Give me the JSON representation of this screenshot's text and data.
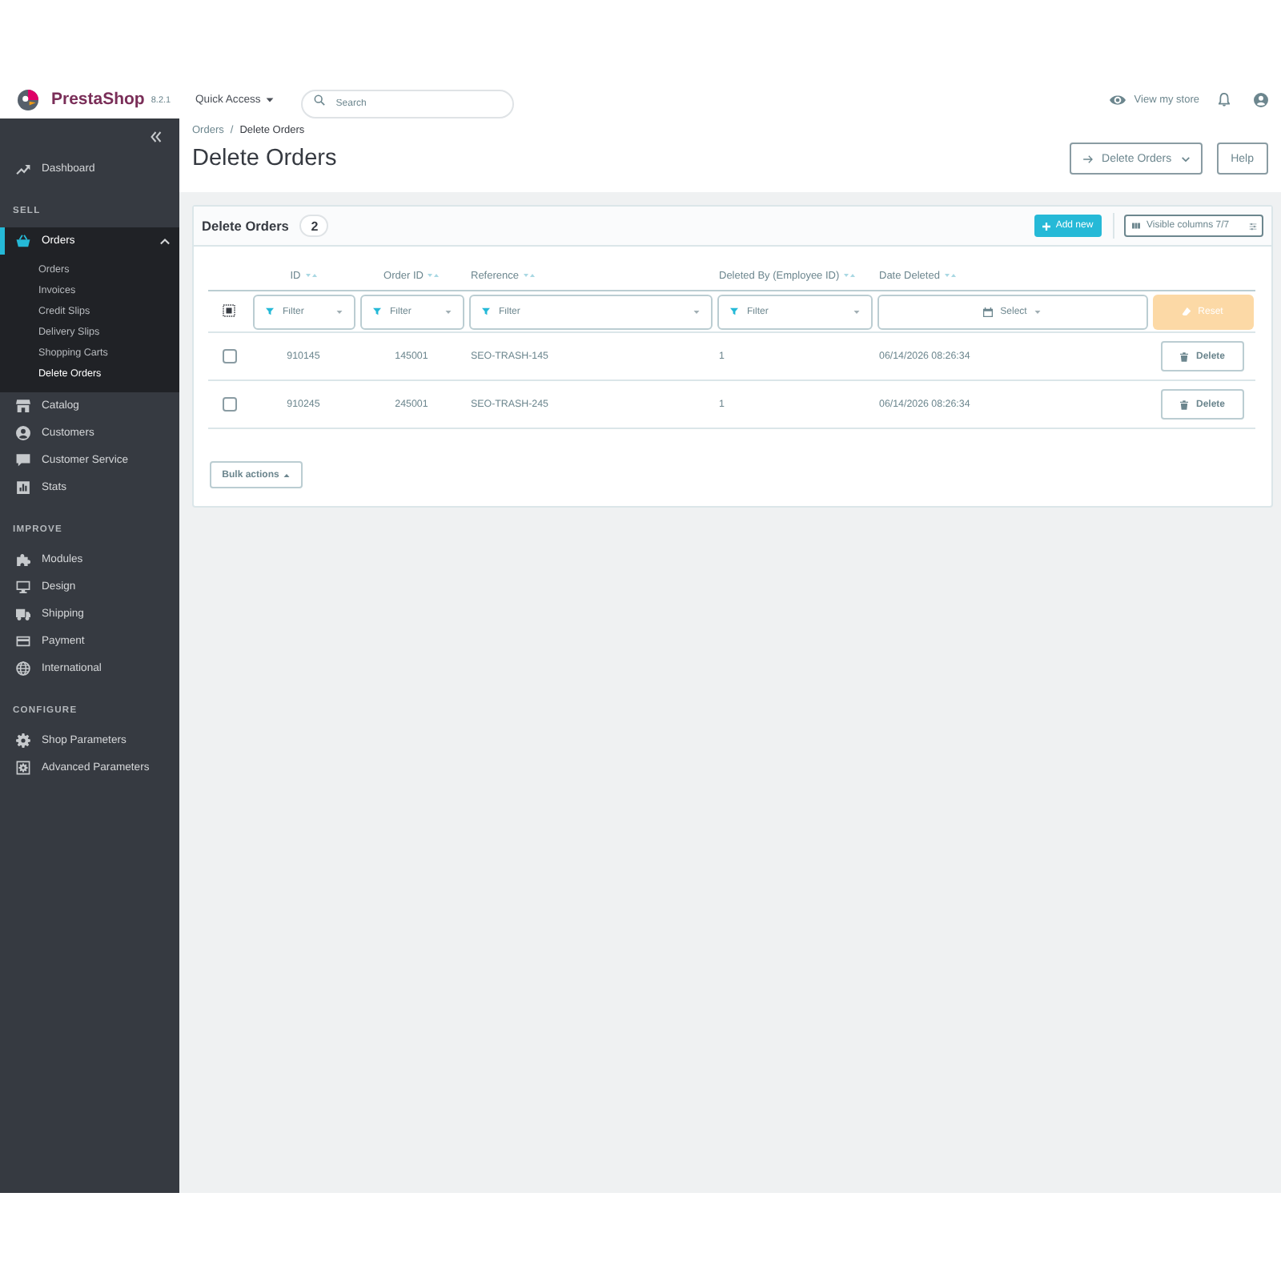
{
  "header": {
    "logo": "PrestaShop",
    "version": "8.2.1",
    "quick_access": "Quick Access",
    "search": {
      "placeholder": "Search"
    },
    "view_store": "View my store"
  },
  "sidebar": {
    "sections": [
      {
        "items": [
          {
            "label": "Dashboard",
            "selected": false
          }
        ]
      },
      {
        "title": "SELL",
        "items": [
          {
            "label": "Orders",
            "selected": true,
            "expanded": true,
            "children": [
              {
                "label": "Orders",
                "selected": false
              },
              {
                "label": "Invoices",
                "selected": false
              },
              {
                "label": "Credit Slips",
                "selected": false
              },
              {
                "label": "Delivery Slips",
                "selected": false
              },
              {
                "label": "Shopping Carts",
                "selected": false
              },
              {
                "label": "Delete Orders",
                "selected": true
              }
            ]
          },
          {
            "label": "Catalog",
            "selected": false
          },
          {
            "label": "Customers",
            "selected": false
          },
          {
            "label": "Customer Service",
            "selected": false
          },
          {
            "label": "Stats",
            "selected": false
          }
        ]
      },
      {
        "title": "IMPROVE",
        "items": [
          {
            "label": "Modules",
            "selected": false
          },
          {
            "label": "Design",
            "selected": false
          },
          {
            "label": "Shipping",
            "selected": false
          },
          {
            "label": "Payment",
            "selected": false
          },
          {
            "label": "International",
            "selected": false
          }
        ]
      },
      {
        "title": "CONFIGURE",
        "items": [
          {
            "label": "Shop Parameters",
            "selected": false
          },
          {
            "label": "Advanced Parameters",
            "selected": false
          }
        ]
      }
    ]
  },
  "page": {
    "breadcrumb": {
      "items": [
        "Orders",
        "Delete Orders"
      ],
      "separator": "/"
    },
    "title": "Delete Orders",
    "toolbar": [
      {
        "kind": "dropdown",
        "label": "Delete Orders"
      },
      {
        "kind": "plain",
        "label": "Help"
      }
    ]
  },
  "card": {
    "title": "Delete Orders",
    "count": "2",
    "add_new": "Add new",
    "visible_columns": "Visible columns 7/7",
    "table": {
      "columns": [
        "ID",
        "Order ID",
        "Reference",
        "Deleted By (Employee ID)",
        "Date Deleted"
      ],
      "filters": [
        {
          "kind": "text",
          "placeholder": "Filter"
        },
        {
          "kind": "text",
          "placeholder": "Filter"
        },
        {
          "kind": "text",
          "placeholder": "Filter"
        },
        {
          "kind": "text",
          "placeholder": "Filter"
        },
        {
          "kind": "date",
          "label": "Select"
        }
      ],
      "reset": {
        "label": "Reset",
        "disabled": true
      },
      "rows": [
        {
          "checked": false,
          "cells": [
            "910145",
            "145001",
            "SEO-TRASH-145",
            "1",
            "06/14/2026 08:26:34"
          ],
          "action": "Delete"
        },
        {
          "checked": false,
          "cells": [
            "910245",
            "245001",
            "SEO-TRASH-245",
            "1",
            "06/14/2026 08:26:34"
          ],
          "action": "Delete"
        }
      ]
    },
    "bulk_actions": "Bulk actions"
  }
}
